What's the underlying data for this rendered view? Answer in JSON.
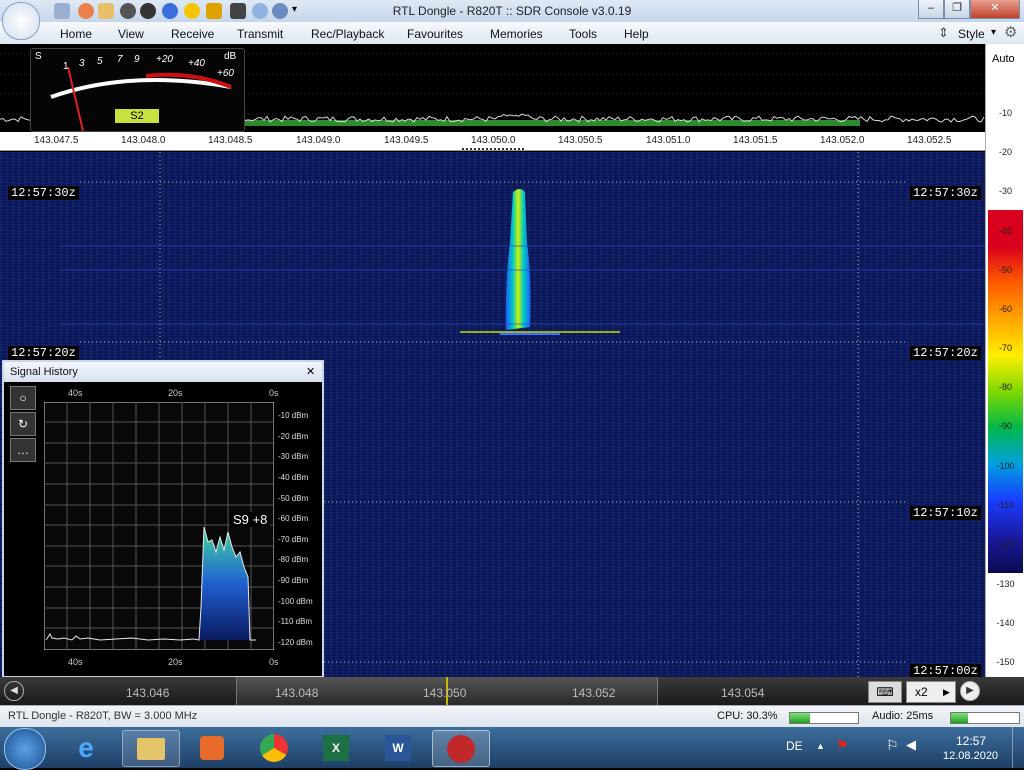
{
  "window": {
    "title": "RTL Dongle - R820T :: SDR Console v3.0.19",
    "min": "–",
    "max": "❐",
    "close": "✕"
  },
  "quick_access": [
    "home-icon",
    "help-icon",
    "folder-icon",
    "play-icon",
    "stop-icon",
    "add-icon",
    "star-icon",
    "lock-icon",
    "camera-icon",
    "droplet-icon",
    "undo-icon",
    "dropdown-icon"
  ],
  "ribbon": {
    "tabs": [
      "Home",
      "View",
      "Receive",
      "Transmit",
      "Rec/Playback",
      "Favourites",
      "Memories",
      "Tools",
      "Help"
    ],
    "style_label": "Style"
  },
  "spectrum": {
    "auto_label": "Auto",
    "smeter": {
      "s_label": "S",
      "db_label": "dB",
      "s_ticks": [
        "1",
        "3",
        "5",
        "7",
        "9"
      ],
      "db_ticks": [
        "+20",
        "+40",
        "+60"
      ],
      "reading": "S2"
    },
    "freq_ticks": [
      "143.047.5",
      "143.048.0",
      "143.048.5",
      "143.049.0",
      "143.049.5",
      "143.050.0",
      "143.050.5",
      "143.051.0",
      "143.051.5",
      "143.052.0",
      "143.052.5"
    ]
  },
  "db_scale": {
    "ticks": [
      "-10",
      "-20",
      "-30",
      "-40",
      "-50",
      "-60",
      "-70",
      "-80",
      "-90",
      "-100",
      "-110",
      "-120",
      "-130",
      "-140",
      "-150"
    ],
    "colors": [
      "#d8001c",
      "#d8001c",
      "#ff5a00",
      "#ffa500",
      "#ffee00",
      "#7fd800",
      "#00b84a",
      "#00a0e0",
      "#1a3cff",
      "#1a1aa0",
      "#0a0a50"
    ]
  },
  "waterfall": {
    "timestamps": [
      "12:57:30z",
      "12:57:20z",
      "12:57:10z",
      "12:57:00z"
    ]
  },
  "signal_history": {
    "title": "Signal History",
    "close": "✕",
    "x_ticks_top": [
      "40s",
      "20s",
      "0s"
    ],
    "x_ticks_bottom": [
      "40s",
      "20s",
      "0s"
    ],
    "y_ticks": [
      "-10 dBm",
      "-20 dBm",
      "-30 dBm",
      "-40 dBm",
      "-50 dBm",
      "-60 dBm",
      "-70 dBm",
      "-80 dBm",
      "-90 dBm",
      "-100 dBm",
      "-110 dBm",
      "-120 dBm"
    ],
    "peak_label": "S9 +8",
    "buttons": [
      "○",
      "↻",
      "…"
    ]
  },
  "tuner": {
    "ticks": [
      "143.046",
      "143.048",
      "143.050",
      "143.052",
      "143.054"
    ],
    "zoom": "x2"
  },
  "status": {
    "device": "RTL Dongle - R820T, BW = 3.000 MHz",
    "cpu": "CPU: 30.3%",
    "cpu_level": 0.3,
    "audio": "Audio: 25ms",
    "audio_level": 0.25
  },
  "taskbar": {
    "apps": [
      "explorer-icon",
      "media-player-icon",
      "chrome-icon",
      "excel-icon",
      "word-icon",
      "sdr-console-icon"
    ],
    "lang": "DE",
    "time": "12:57",
    "date": "12.08.2020"
  }
}
